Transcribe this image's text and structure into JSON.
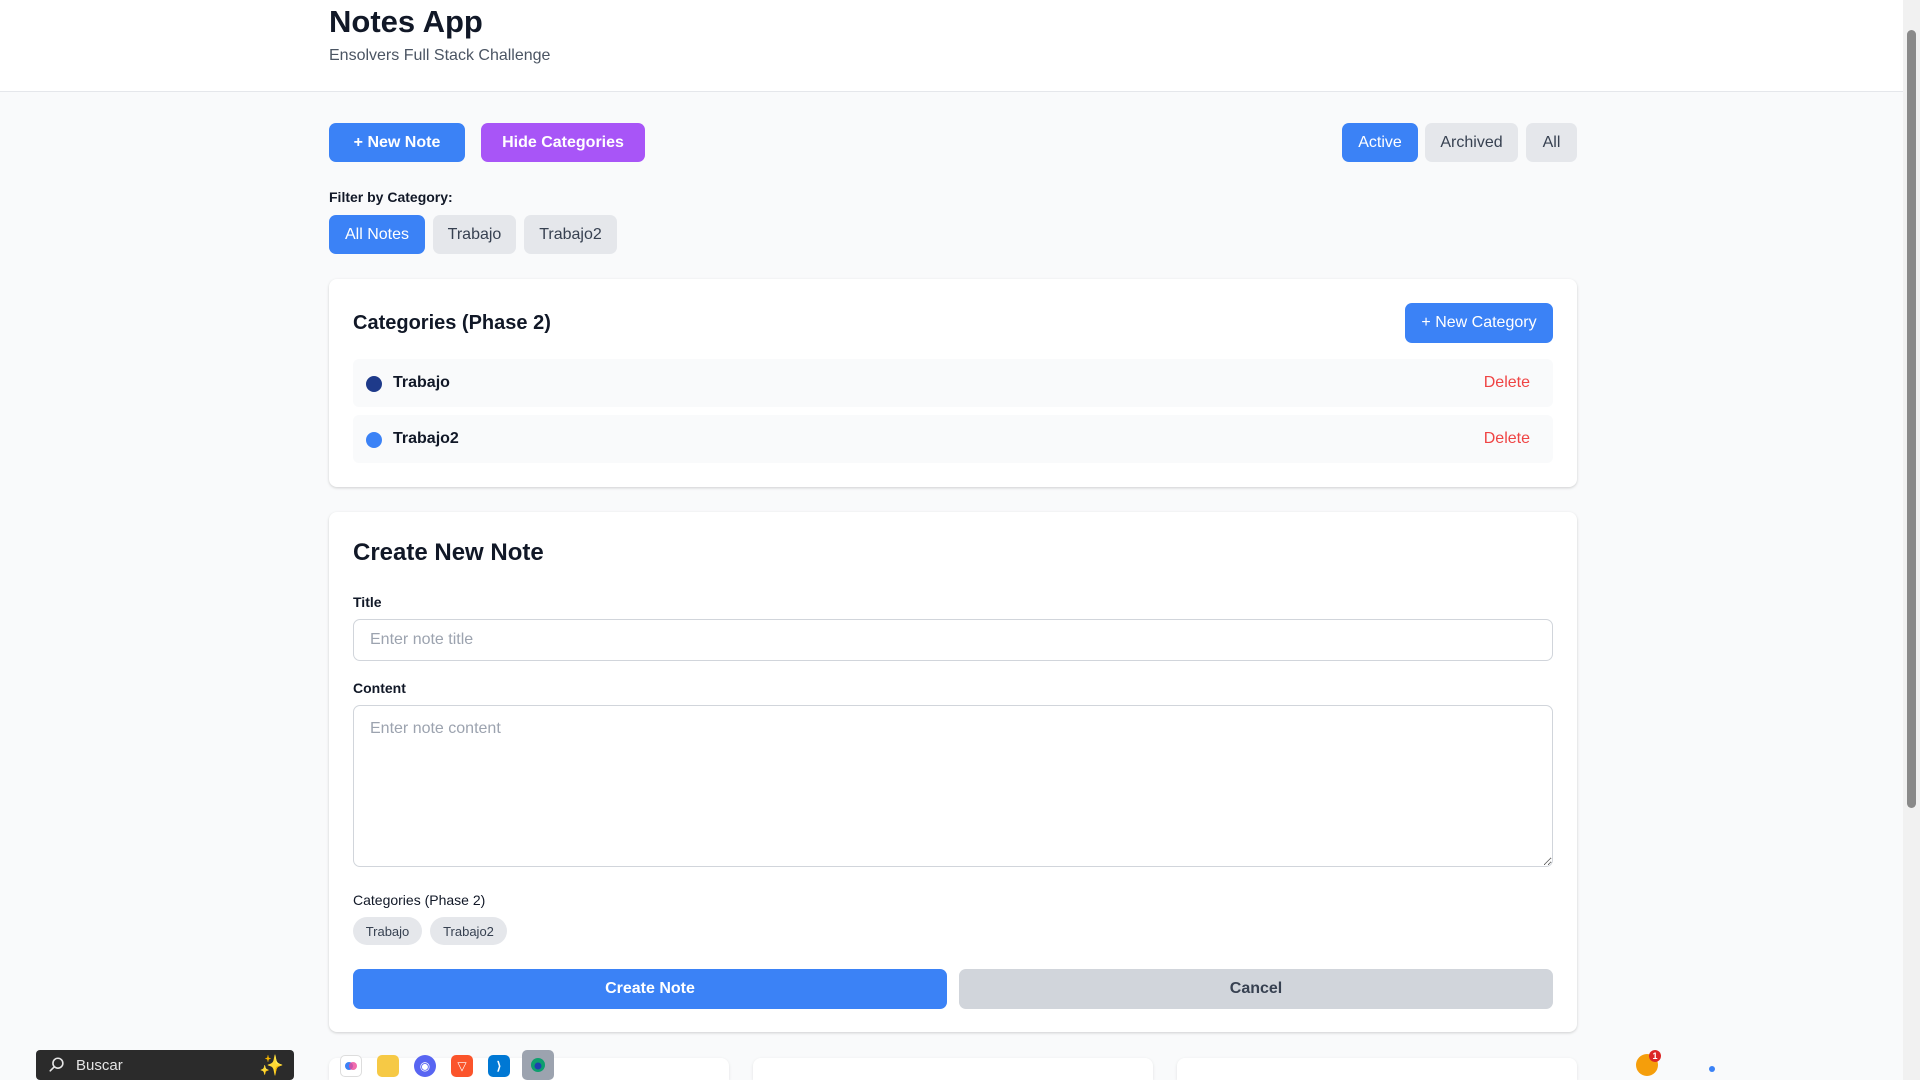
{
  "header": {
    "title": "Notes App",
    "subtitle": "Ensolvers Full Stack Challenge"
  },
  "toolbar": {
    "new_note_label": "+ New Note",
    "hide_categories_label": "Hide Categories",
    "status_tabs": [
      "Active",
      "Archived",
      "All"
    ],
    "selected_status": "Active"
  },
  "filter": {
    "label": "Filter by Category:",
    "options": [
      "All Notes",
      "Trabajo",
      "Trabajo2"
    ],
    "selected": "All Notes"
  },
  "categories_panel": {
    "title": "Categories (Phase 2)",
    "new_category_label": "+ New Category",
    "delete_label": "Delete",
    "items": [
      {
        "name": "Trabajo",
        "color": "#1e3a8a"
      },
      {
        "name": "Trabajo2",
        "color": "#3b82f6"
      }
    ]
  },
  "create_note": {
    "title": "Create New Note",
    "title_label": "Title",
    "title_placeholder": "Enter note title",
    "title_value": "",
    "content_label": "Content",
    "content_placeholder": "Enter note content",
    "content_value": "",
    "categories_label": "Categories (Phase 2)",
    "category_chips": [
      "Trabajo",
      "Trabajo2"
    ],
    "submit_label": "Create Note",
    "cancel_label": "Cancel"
  },
  "taskbar": {
    "search_label": "Buscar",
    "notification_count": "1"
  },
  "colors": {
    "primary": "#3b82f6",
    "purple": "#a855f7",
    "danger": "#ef4444",
    "gray_button": "#e5e7eb"
  }
}
